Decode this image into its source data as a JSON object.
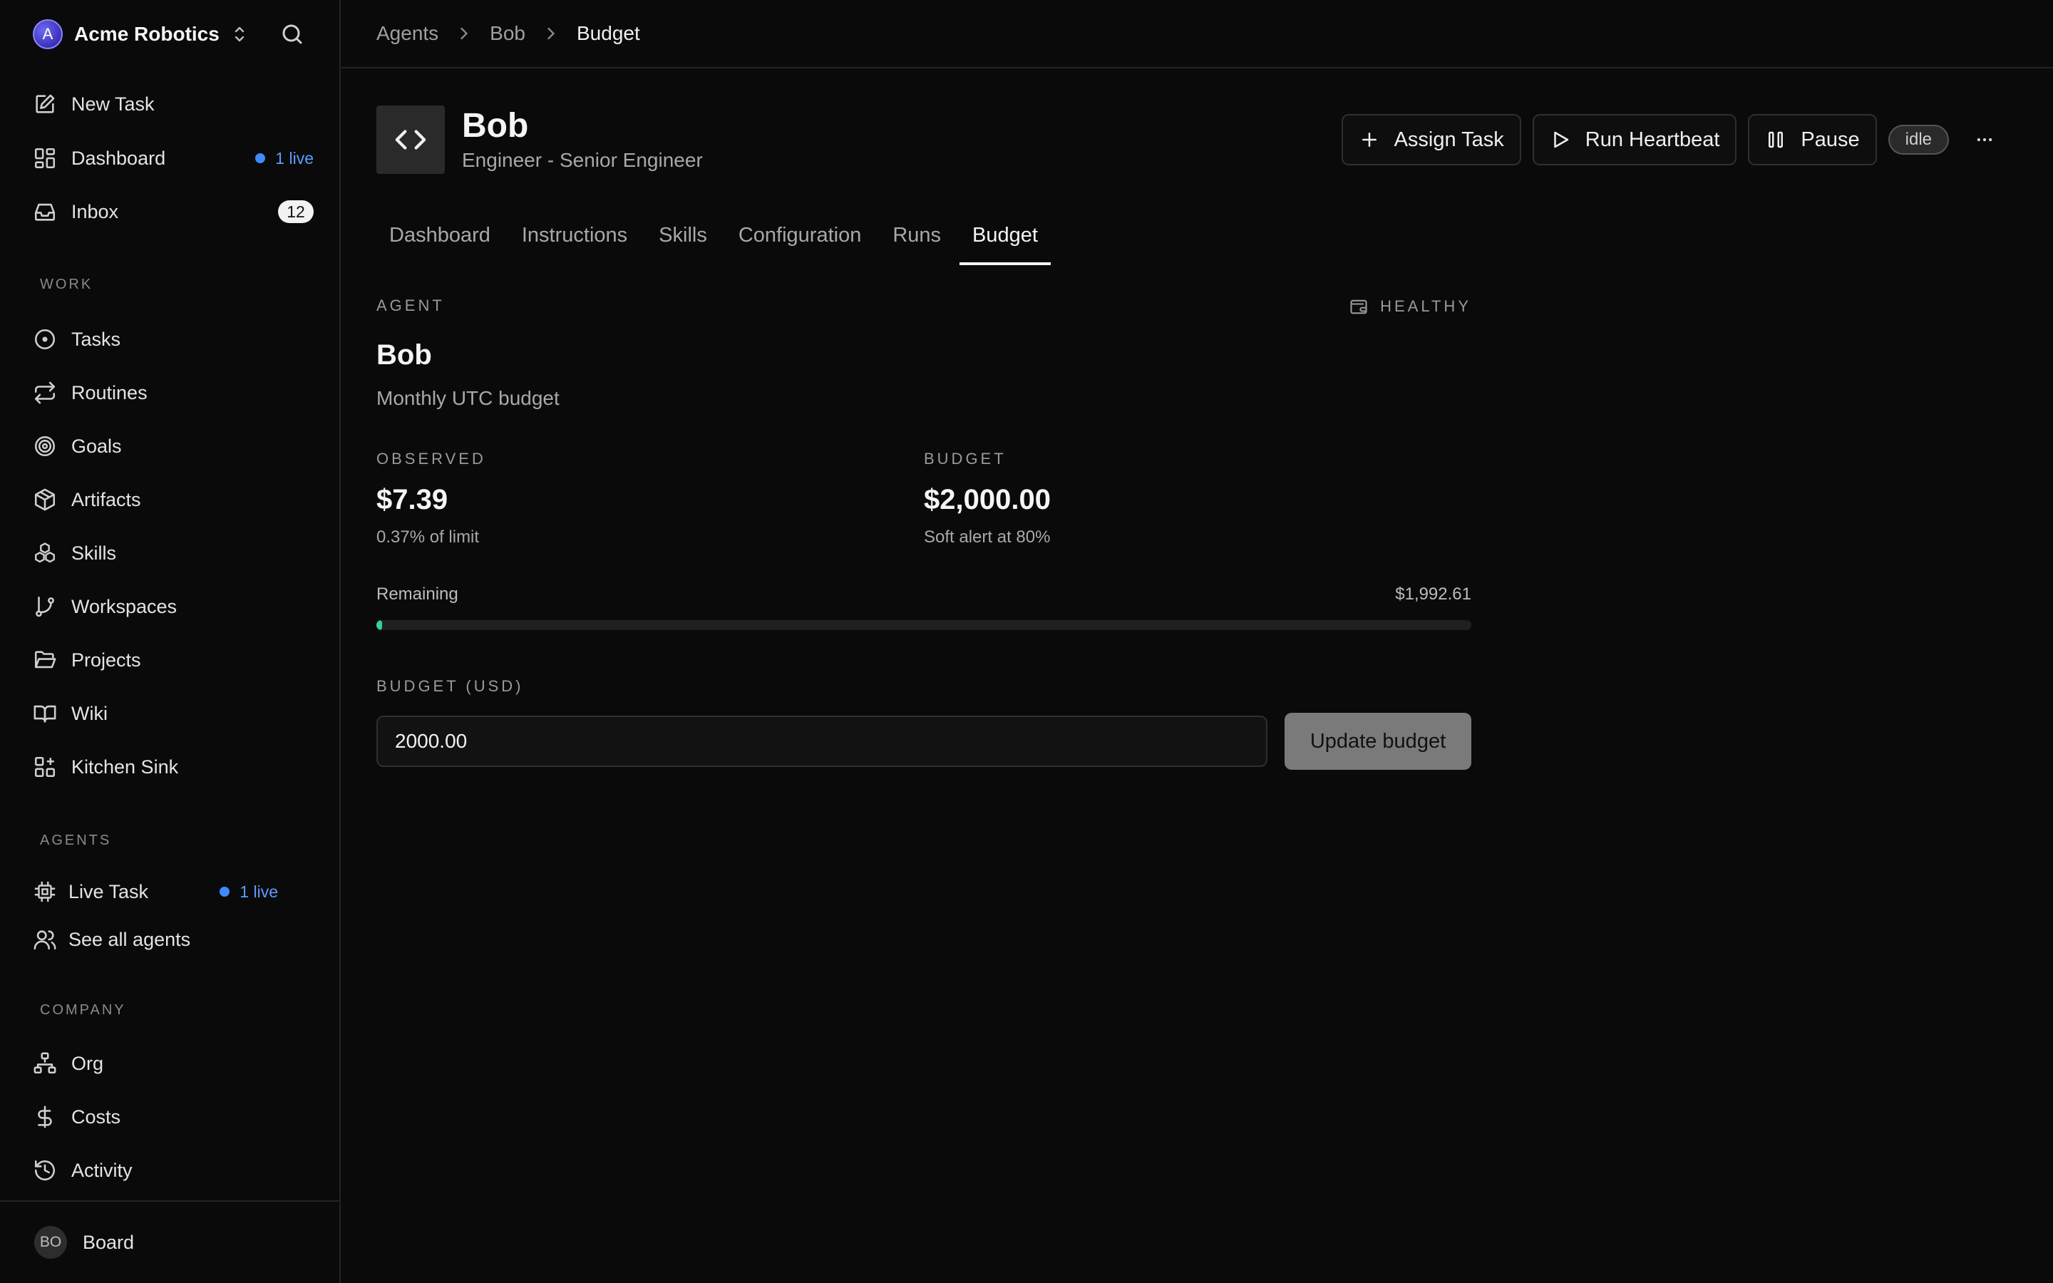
{
  "company": {
    "name": "Acme Robotics",
    "logo_letter": "A"
  },
  "nav_top": [
    {
      "label": "New Task"
    },
    {
      "label": "Dashboard",
      "live": "1 live"
    },
    {
      "label": "Inbox",
      "count": "12"
    }
  ],
  "sections": {
    "work": "WORK",
    "agents": "AGENTS",
    "company": "COMPANY"
  },
  "nav_work": [
    {
      "label": "Tasks"
    },
    {
      "label": "Routines"
    },
    {
      "label": "Goals"
    },
    {
      "label": "Artifacts"
    },
    {
      "label": "Skills"
    },
    {
      "label": "Workspaces"
    },
    {
      "label": "Projects"
    },
    {
      "label": "Wiki"
    },
    {
      "label": "Kitchen Sink"
    }
  ],
  "nav_agents": [
    {
      "label": "Live Task",
      "live": "1 live"
    },
    {
      "label": "See all agents"
    }
  ],
  "nav_company": [
    {
      "label": "Org"
    },
    {
      "label": "Costs"
    },
    {
      "label": "Activity"
    }
  ],
  "footer": {
    "initials": "BO",
    "label": "Board"
  },
  "breadcrumb": [
    "Agents",
    "Bob",
    "Budget"
  ],
  "agent": {
    "name": "Bob",
    "role": "Engineer - Senior Engineer",
    "status": "idle"
  },
  "actions": {
    "assign": "Assign Task",
    "heartbeat": "Run Heartbeat",
    "pause": "Pause"
  },
  "tabs": [
    {
      "label": "Dashboard"
    },
    {
      "label": "Instructions"
    },
    {
      "label": "Skills"
    },
    {
      "label": "Configuration"
    },
    {
      "label": "Runs"
    },
    {
      "label": "Budget",
      "active": true
    }
  ],
  "budget": {
    "eyebrow": "AGENT",
    "health": "HEALTHY",
    "title": "Bob",
    "subtitle": "Monthly UTC budget",
    "observed_label": "OBSERVED",
    "observed_value": "$7.39",
    "observed_note": "0.37% of limit",
    "budget_label": "BUDGET",
    "budget_value": "$2,000.00",
    "budget_note": "Soft alert at 80%",
    "remaining_label": "Remaining",
    "remaining_value": "$1,992.61",
    "used_percent": 0.37,
    "form_label": "BUDGET (USD)",
    "input_value": "2000.00",
    "update_label": "Update budget"
  },
  "colors": {
    "accent_live": "#3d8bff",
    "progress": "#33d39a",
    "background": "#0a0a0a"
  }
}
